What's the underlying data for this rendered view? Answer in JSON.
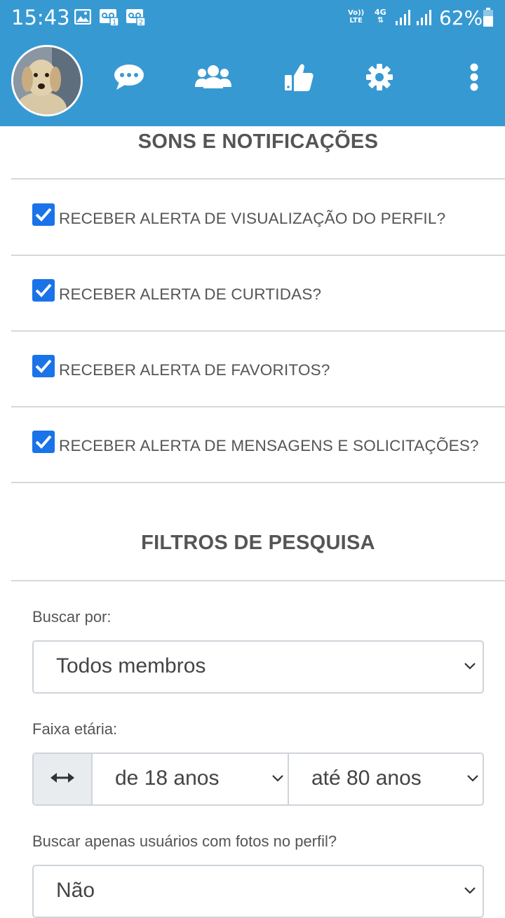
{
  "status_bar": {
    "time": "15:43",
    "left_icons": [
      "image-icon",
      "voicemail-1-icon",
      "voicemail-2-icon"
    ],
    "volte_top": "Vo))",
    "volte_bottom": "LTE",
    "network": "4G",
    "battery": "62%",
    "battery_level": 0.62
  },
  "header": {
    "background": "#3799d2",
    "icons": [
      "avatar",
      "chat-icon",
      "users-icon",
      "thumbs-up-icon",
      "gear-icon",
      "more-vertical-icon"
    ]
  },
  "notifications": {
    "title": "SONS E NOTIFICAÇÕES",
    "items": [
      {
        "label": "RECEBER ALERTA DE VISUALIZAÇÃO DO PERFIL?",
        "checked": true
      },
      {
        "label": "RECEBER ALERTA DE CURTIDAS?",
        "checked": true
      },
      {
        "label": "RECEBER ALERTA DE FAVORITOS?",
        "checked": true
      },
      {
        "label": "RECEBER ALERTA DE MENSAGENS E SOLICITAÇÕES?",
        "checked": true
      }
    ]
  },
  "filters": {
    "title": "FILTROS DE PESQUISA",
    "search_by_label": "Buscar por:",
    "search_by_value": "Todos membros",
    "age_label": "Faixa etária:",
    "age_from": "de 18 anos",
    "age_to": "até 80 anos",
    "photo_label": "Buscar apenas usuários com fotos no perfil?",
    "photo_value": "Não"
  },
  "colors": {
    "accent": "#3799d2",
    "checkbox": "#1a73e8",
    "text": "#555555"
  }
}
